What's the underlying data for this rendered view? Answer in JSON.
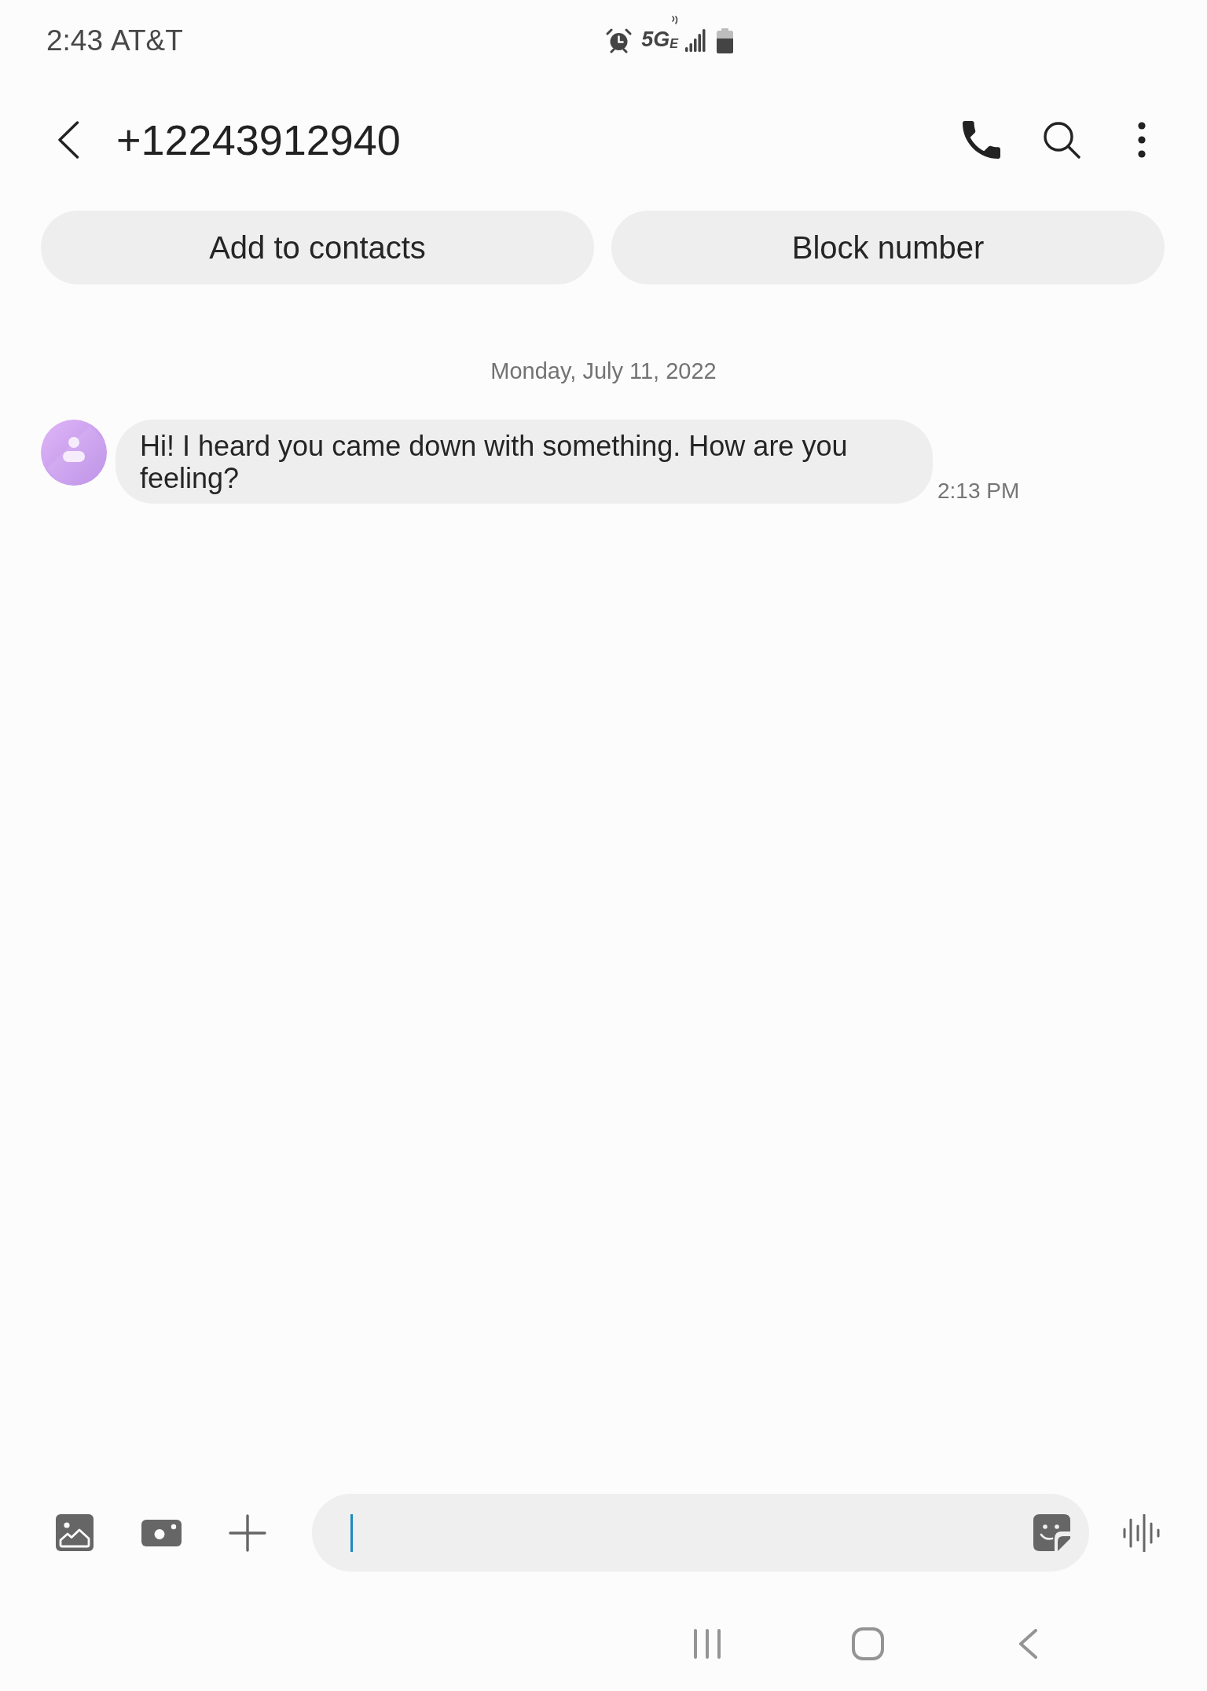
{
  "status_bar": {
    "time": "2:43",
    "carrier": "AT&T",
    "network": "5G$_{E}$"
  },
  "header": {
    "title": "+12243912940"
  },
  "actions": [
    "Add to contacts",
    "Block number"
  ],
  "conversation": {
    "date": "Monday, July 11, 2022",
    "messages": [
      {
        "kind": "incoming",
        "text": "Hi! I heard you came down with something. How are you feeling?",
        "time": "2:13 PM"
      }
    ]
  },
  "composer": {
    "focused": true
  }
}
